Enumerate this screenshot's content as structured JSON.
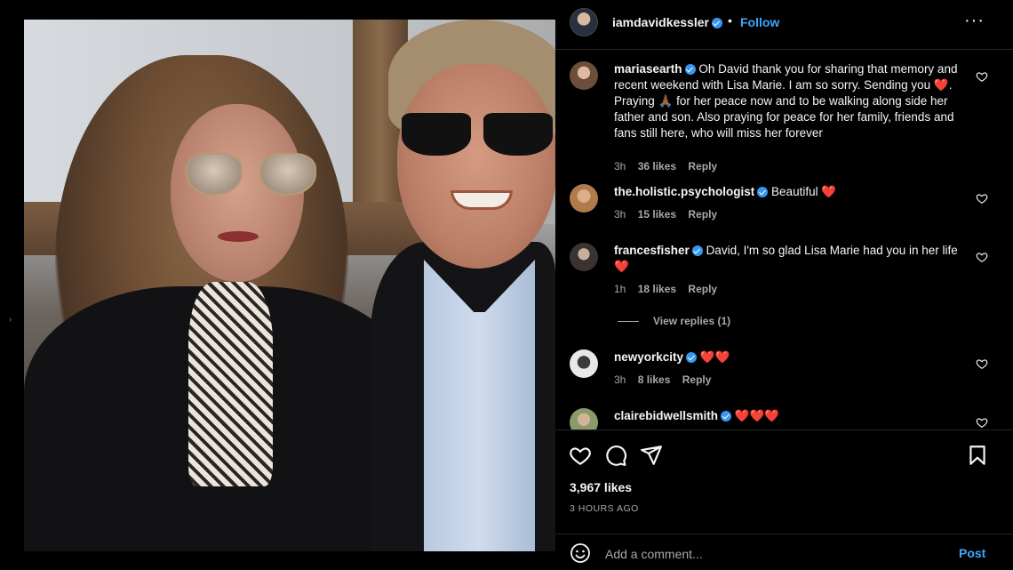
{
  "post": {
    "author": "iamdavidkessler",
    "follow_label": "Follow",
    "separator": "•",
    "more_label": "···"
  },
  "comments": [
    {
      "user": "mariasearth",
      "verified": true,
      "text_before_heart": "Oh David thank you for sharing that memory and recent weekend with Lisa Marie. I am so sorry. Sending you ",
      "heart": "❤️",
      "text_mid": ". Praying ",
      "pray": "🙏🏾",
      "text_after": " for her peace now and to be walking along side her father and son. Also praying for peace for her family, friends and fans still here, who will miss her forever",
      "time": "3h",
      "likes": "36 likes",
      "reply": "Reply"
    },
    {
      "user": "the.holistic.psychologist",
      "verified": true,
      "text": "Beautiful",
      "hearts": "❤️",
      "time": "3h",
      "likes": "15 likes",
      "reply": "Reply"
    },
    {
      "user": "francesfisher",
      "verified": true,
      "text": "David, I'm so glad Lisa Marie had you in her life",
      "hearts": "❤️",
      "time": "1h",
      "likes": "18 likes",
      "reply": "Reply",
      "view_replies": "View replies (1)"
    },
    {
      "user": "newyorkcity",
      "verified": true,
      "text": "",
      "hearts": "❤️❤️",
      "time": "3h",
      "likes": "8 likes",
      "reply": "Reply"
    },
    {
      "user": "clairebidwellsmith",
      "verified": true,
      "text": "",
      "hearts": "❤️❤️❤️"
    }
  ],
  "stats": {
    "likes": "3,967 likes",
    "time_ago": "3 HOURS AGO"
  },
  "add_comment": {
    "placeholder": "Add a comment...",
    "post_label": "Post"
  },
  "icons": {
    "like": "heart-icon",
    "comment": "comment-icon",
    "share": "share-icon",
    "save": "bookmark-icon",
    "emoji": "emoji-icon",
    "more": "more-icon"
  },
  "colors": {
    "background": "#000000",
    "link": "#3ea7ff",
    "verified": "#3897f0",
    "muted": "#a8a8a8",
    "heart": "#ed4956"
  }
}
